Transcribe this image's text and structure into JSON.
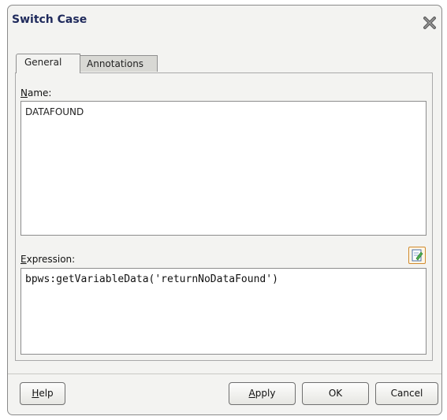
{
  "dialog": {
    "title": "Switch Case",
    "close_icon": "close-x-icon"
  },
  "tabs": [
    {
      "label": "General",
      "selected": true
    },
    {
      "label": "Annotations",
      "selected": false
    }
  ],
  "name": {
    "label_accel": "N",
    "label_rest": "ame:",
    "value": "DATAFOUND"
  },
  "expression": {
    "label_accel": "E",
    "label_rest": "xpression:",
    "value": "bpws:getVariableData('returnNoDataFound')",
    "edit_icon": "expression-builder-icon"
  },
  "buttons": {
    "help_accel": "H",
    "help_rest": "elp",
    "apply_accel": "A",
    "apply_rest": "pply",
    "ok": "OK",
    "cancel": "Cancel"
  }
}
